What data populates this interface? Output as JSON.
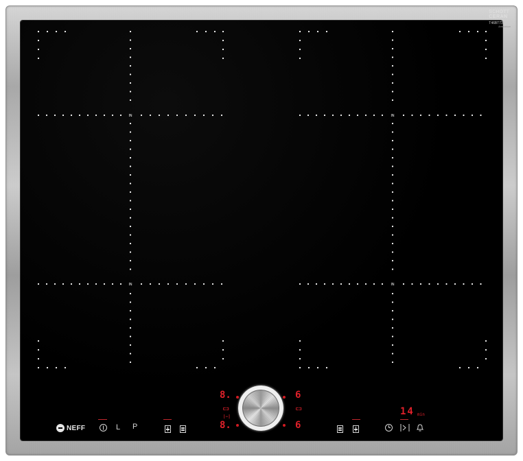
{
  "brand": {
    "logo_text": "NEFF",
    "glass_brand_line1": "SCHOTT",
    "glass_brand_line2": "CERAN",
    "model_line": "T46BT73N2",
    "model_sub": "Ammonium"
  },
  "zones": {
    "flex_marker": "IN"
  },
  "controls": {
    "power_icon": "power-icon",
    "lock_label": "L",
    "program_label": "P",
    "left_zone_icons": [
      "zone-front-icon",
      "zone-rear-icon"
    ],
    "right_zone_icons": [
      "zone-front-icon",
      "zone-rear-icon"
    ],
    "timer_icons": [
      "clock-icon",
      "powerboost-icon",
      "bell-icon"
    ],
    "timer_value": "14",
    "timer_unit": "min",
    "displays": {
      "front_left_level": "8.",
      "rear_left_level": "8.",
      "front_right_level": "6",
      "rear_right_level": "6"
    }
  },
  "colors": {
    "glass": "#000000",
    "frame": "#b5b5b5",
    "dot": "#ffffff",
    "display_red": "#e0202a"
  }
}
